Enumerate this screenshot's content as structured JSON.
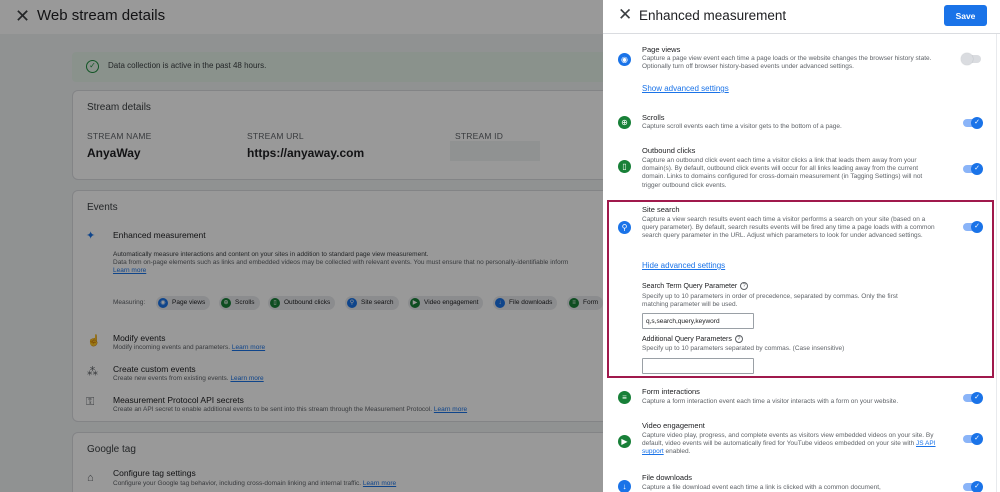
{
  "background": {
    "title": "Web stream details",
    "banner": "Data collection is active in the past 48 hours.",
    "stream_details": {
      "heading": "Stream details",
      "name_label": "STREAM NAME",
      "name_value": "AnyaWay",
      "url_label": "STREAM URL",
      "url_value": "https://anyaway.com",
      "id_label": "STREAM ID"
    },
    "events": {
      "heading": "Events",
      "enhanced_title": "Enhanced measurement",
      "enhanced_desc_bold": "Automatically measure interactions and content on your sites in addition to standard page view measurement.",
      "enhanced_desc": "Data from on-page elements such as links and embedded videos may be collected with relevant events. You must ensure that no personally-identifiable inform",
      "learn_more": "Learn more",
      "measuring_label": "Measuring:",
      "chips": [
        "Page views",
        "Scrolls",
        "Outbound clicks",
        "Site search",
        "Video engagement",
        "File downloads",
        "Form"
      ],
      "modify_title": "Modify events",
      "modify_desc": "Modify incoming events and parameters.",
      "custom_title": "Create custom events",
      "custom_desc": "Create new events from existing events.",
      "mp_title": "Measurement Protocol API secrets",
      "mp_desc": "Create an API secret to enable additional events to be sent into this stream through the Measurement Protocol."
    },
    "google_tag": {
      "heading": "Google tag",
      "configure_title": "Configure tag settings",
      "configure_desc": "Configure your Google tag behavior, including cross-domain linking and internal traffic."
    }
  },
  "panel": {
    "title": "Enhanced measurement",
    "save_label": "Save",
    "sections": {
      "page_views": {
        "title": "Page views",
        "desc": "Capture a page view event each time a page loads or the website changes the browser history state. Optionally turn off browser history-based events under advanced settings.",
        "link": "Show advanced settings",
        "enabled": false
      },
      "scrolls": {
        "title": "Scrolls",
        "desc": "Capture scroll events each time a visitor gets to the bottom of a page.",
        "enabled": true
      },
      "outbound": {
        "title": "Outbound clicks",
        "desc": "Capture an outbound click event each time a visitor clicks a link that leads them away from your domain(s). By default, outbound click events will occur for all links leading away from the current domain. Links to domains configured for cross-domain measurement (in Tagging Settings) will not trigger outbound click events.",
        "enabled": true
      },
      "site_search": {
        "title": "Site search",
        "desc": "Capture a view search results event each time a visitor performs a search on your site (based on a query parameter). By default, search results events will be fired any time a page loads with a common search query parameter in the URL. Adjust which parameters to look for under advanced settings.",
        "link": "Hide advanced settings",
        "enabled": true,
        "term_label": "Search Term Query Parameter",
        "term_desc": "Specify up to 10 parameters in order of precedence, separated by commas. Only the first matching parameter will be used.",
        "term_value": "q,s,search,query,keyword",
        "additional_label": "Additional Query Parameters",
        "additional_desc": "Specify up to 10 parameters separated by commas. (Case insensitive)",
        "additional_value": ""
      },
      "form": {
        "title": "Form interactions",
        "desc": "Capture a form interaction event each time a visitor interacts with a form on your website.",
        "enabled": true
      },
      "video": {
        "title": "Video engagement",
        "desc_pre": "Capture video play, progress, and complete events as visitors view embedded videos on your site. By default, video events will be automatically fired for YouTube videos embedded on your site with ",
        "desc_link": "JS API support",
        "desc_post": " enabled.",
        "enabled": true
      },
      "downloads": {
        "title": "File downloads",
        "desc": "Capture a file download event each time a link is clicked with a common document,",
        "enabled": true
      }
    }
  },
  "colors": {
    "accent": "#1a73e8",
    "highlight_border": "#a0194c",
    "icon_blue": "#1a73e8",
    "icon_green": "#188038"
  },
  "icons": {
    "close": "close-icon",
    "page_views": "eye-icon",
    "scrolls": "crosshair-icon",
    "outbound": "mouse-icon",
    "site_search": "search-icon",
    "form": "form-icon",
    "video": "play-icon",
    "downloads": "download-icon"
  }
}
